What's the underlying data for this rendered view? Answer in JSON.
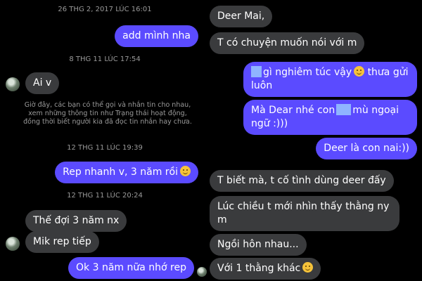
{
  "left_chat": {
    "timestamps": [
      "26 THG 2, 2017 LÚC 16:01",
      "8 THG 11 LÚC 17:54",
      "12 THG 11 LÚC 19:39",
      "12 THG 11 LÚC 20:24"
    ],
    "messages": [
      {
        "text": "add mình nha",
        "sender": "me"
      },
      {
        "text": "Ai v",
        "sender": "other"
      },
      {
        "text": "Rep nhanh v, 3 năm rồi",
        "sender": "me",
        "emoji": "grimace-icon"
      },
      {
        "text": "Thế đợi 3 năm nx",
        "sender": "other"
      },
      {
        "text": "Mik rep tiếp",
        "sender": "other"
      },
      {
        "text": "Ok 3 năm nữa nhớ rep",
        "sender": "me"
      }
    ],
    "notice": "Giờ đây, các bạn có thể gọi và nhắn tin cho nhau, xem những thông tin như Trạng thái hoạt động, đồng thời biết người kia đã đọc tin nhắn hay chưa."
  },
  "right_chat": {
    "messages": [
      {
        "text": "Deer Mai,",
        "sender": "other"
      },
      {
        "text": "T có chuyện muốn nói với m",
        "sender": "other"
      },
      {
        "text": "gì nghiêm túc vậy",
        "text2": "thưa gửi",
        "text3": "luôn",
        "sender": "me",
        "emoji": "smile-icon"
      },
      {
        "text": "Mà Dear nhé con",
        "text2": "mù ngoại",
        "text3": "ngữ :)))",
        "sender": "me"
      },
      {
        "text": "Deer là con nai:))",
        "sender": "me"
      },
      {
        "text": "T biết mà, t cố tình dùng deer đấy",
        "sender": "other"
      },
      {
        "text": "Lúc chiều t mới nhìn thấy thằng ny",
        "text2": "m",
        "sender": "other"
      },
      {
        "text": "Ngồi hôn nhau...",
        "sender": "other"
      },
      {
        "text": "Với 1 thằng khác",
        "sender": "other",
        "emoji": "laughing-icon"
      }
    ]
  },
  "colors": {
    "background": "#000000",
    "my_bubble": "#5b4bff",
    "their_bubble": "#3a3b3d",
    "timestamp": "#9a9a9a"
  }
}
